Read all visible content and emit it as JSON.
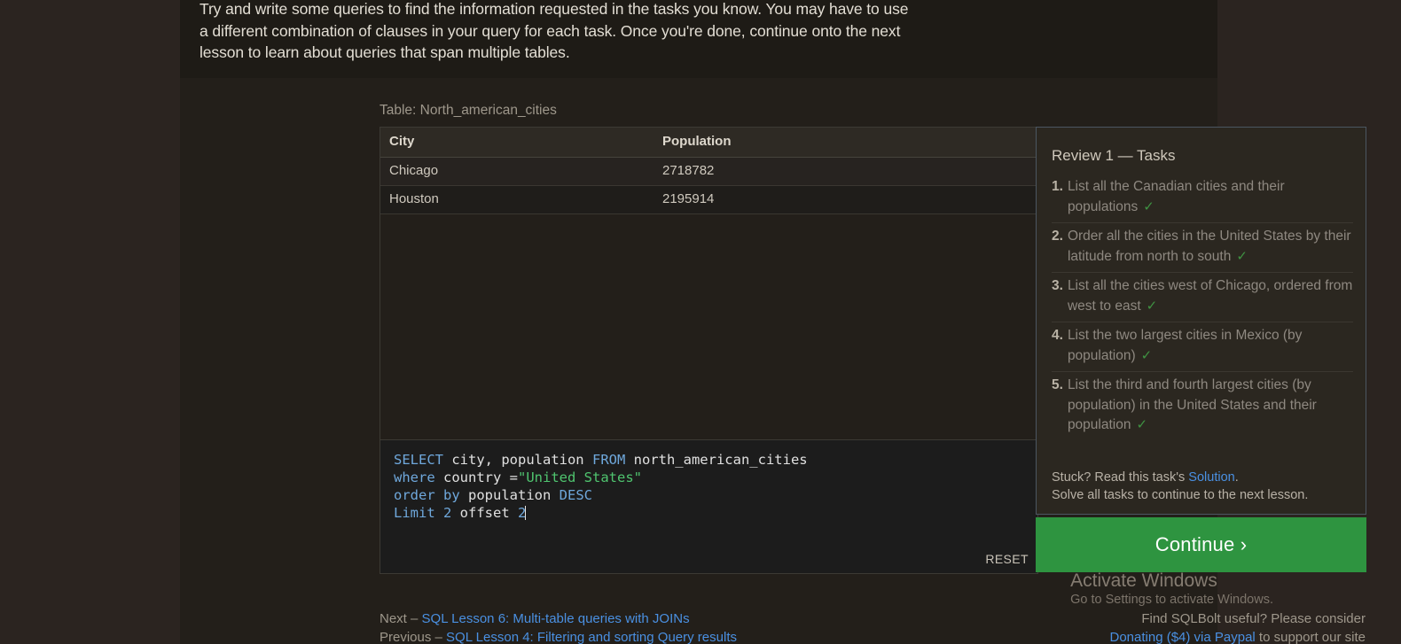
{
  "lesson": {
    "intro_paragraph": "Try and write some queries to find the information requested in the tasks you know. You may have to use a different combination of clauses in your query for each task. Once you're done, continue onto the next lesson to learn about queries that span multiple tables."
  },
  "table_caption": "Table: North_american_cities",
  "results": {
    "columns": [
      "City",
      "Population"
    ],
    "rows": [
      [
        "Chicago",
        "2718782"
      ],
      [
        "Houston",
        "2195914"
      ]
    ]
  },
  "editor": {
    "line1": {
      "select": "SELECT",
      "cols": " city, population ",
      "from": "FROM",
      "table": " north_american_cities"
    },
    "line2": {
      "where": "where",
      "field": " country ",
      "eq": "=",
      "value": "\"United States\""
    },
    "line3": {
      "order": "order",
      "by": " by",
      "field": " population ",
      "desc": "DESC"
    },
    "line4": {
      "limit": "Limit",
      "n1": " 2",
      "offset": " offset ",
      "n2": "2"
    },
    "reset_label": "RESET"
  },
  "tasks_panel": {
    "title": "Review 1 — Tasks",
    "check_glyph": "✓",
    "check_color": "#3f9242",
    "items": [
      {
        "num": "1.",
        "text": "List all the Canadian cities and their populations",
        "done": true
      },
      {
        "num": "2.",
        "text": "Order all the cities in the United States by their latitude from north to south",
        "done": true
      },
      {
        "num": "3.",
        "text": "List all the cities west of Chicago, ordered from west to east",
        "done": true
      },
      {
        "num": "4.",
        "text": "List the two largest cities in Mexico (by population)",
        "done": true
      },
      {
        "num": "5.",
        "text": "List the third and fourth largest cities (by population) in the United States and their population",
        "done": true
      }
    ],
    "stuck_prefix": "Stuck? Read this task's ",
    "stuck_link": "Solution",
    "stuck_suffix": ".",
    "solve_note": "Solve all tasks to continue to the next lesson.",
    "continue_label": "Continue ›",
    "continue_color": "#2e9440"
  },
  "footer": {
    "next_prefix": "Next – ",
    "next_link": "SQL Lesson 6: Multi-table queries with JOINs",
    "prev_prefix": "Previous – ",
    "prev_link": "SQL Lesson 4: Filtering and sorting Query results",
    "support_line1": "Find SQLBolt useful? Please consider",
    "support_link": "Donating ($4) via Paypal",
    "support_line2_suffix": " to support our site"
  },
  "watermark": {
    "title": "Activate Windows",
    "subtitle": "Go to Settings to activate Windows."
  }
}
